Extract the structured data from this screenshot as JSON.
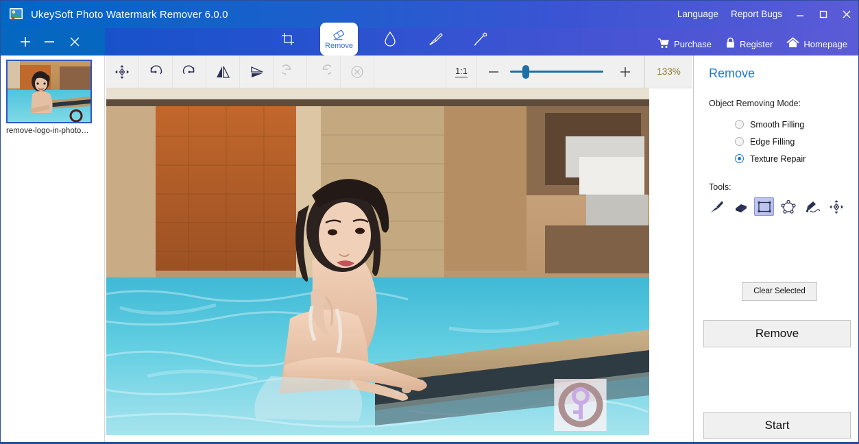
{
  "window": {
    "title": "UkeySoft Photo Watermark Remover 6.0.0",
    "logo_icon": "app-photo-icon",
    "menu": [
      {
        "label": "Language",
        "name": "language-menu"
      },
      {
        "label": "Report Bugs",
        "name": "report-bugs-menu"
      }
    ],
    "controls": [
      {
        "name": "minimize-button",
        "icon": "minimize-icon"
      },
      {
        "name": "maximize-button",
        "icon": "maximize-icon"
      },
      {
        "name": "close-button",
        "icon": "close-icon"
      }
    ]
  },
  "ribbon": {
    "library_actions": [
      {
        "name": "add-image-button",
        "icon": "plus-icon"
      },
      {
        "name": "remove-image-button",
        "icon": "minus-icon"
      },
      {
        "name": "clear-images-button",
        "icon": "close-icon"
      }
    ],
    "tools": [
      {
        "label": "",
        "icon": "crop-icon",
        "name": "tab-crop",
        "active": false
      },
      {
        "label": "Remove",
        "icon": "eraser-icon",
        "name": "tab-remove",
        "active": true
      },
      {
        "label": "",
        "icon": "water-drop-icon",
        "name": "tab-blur",
        "active": false
      },
      {
        "label": "",
        "icon": "brush-icon",
        "name": "tab-brush",
        "active": false
      },
      {
        "label": "",
        "icon": "magic-wand-icon",
        "name": "tab-magic",
        "active": false
      }
    ],
    "links": [
      {
        "label": "Purchase",
        "icon": "cart-icon",
        "name": "purchase-link"
      },
      {
        "label": "Register",
        "icon": "lock-icon",
        "name": "register-link"
      },
      {
        "label": "Homepage",
        "icon": "home-icon",
        "name": "homepage-link"
      }
    ]
  },
  "sidebar": {
    "thumbnail": {
      "filename": "remove-logo-in-photo…",
      "selected": true
    }
  },
  "canvas_toolbar": {
    "buttons": [
      {
        "name": "move-tool-button",
        "icon": "move-icon",
        "disabled": false
      },
      {
        "name": "rotate-left-button",
        "icon": "rotate-left-icon",
        "disabled": false
      },
      {
        "name": "rotate-right-button",
        "icon": "rotate-right-icon",
        "disabled": false
      },
      {
        "name": "flip-horizontal-button",
        "icon": "flip-horizontal-icon",
        "disabled": false
      },
      {
        "name": "flip-vertical-button",
        "icon": "flip-vertical-icon",
        "disabled": false
      },
      {
        "name": "undo-button",
        "icon": "undo-icon",
        "disabled": true
      },
      {
        "name": "redo-button",
        "icon": "redo-icon",
        "disabled": true
      },
      {
        "name": "reset-button",
        "icon": "cancel-circle-icon",
        "disabled": true
      }
    ],
    "fit_ratio_label": "1:1",
    "zoom_out_icon": "minus-icon",
    "zoom_in_icon": "plus-icon",
    "zoom_slider_percent": 14,
    "zoom_value": "133%"
  },
  "panel": {
    "title": "Remove",
    "mode_label": "Object Removing Mode:",
    "modes": [
      {
        "label": "Smooth Filling",
        "selected": false,
        "name": "radio-smooth-filling"
      },
      {
        "label": "Edge Filling",
        "selected": false,
        "name": "radio-edge-filling"
      },
      {
        "label": "Texture Repair",
        "selected": true,
        "name": "radio-texture-repair"
      }
    ],
    "tools_label": "Tools:",
    "tools": [
      {
        "icon": "brush-icon",
        "name": "tool-brush",
        "selected": false
      },
      {
        "icon": "eraser-icon",
        "name": "tool-eraser",
        "selected": false
      },
      {
        "icon": "rectangle-select-icon",
        "name": "tool-rectangle-select",
        "selected": true
      },
      {
        "icon": "polygon-select-icon",
        "name": "tool-polygon-select",
        "selected": false
      },
      {
        "icon": "pen-select-icon",
        "name": "tool-pen-select",
        "selected": false
      },
      {
        "icon": "move-icon",
        "name": "tool-move",
        "selected": false
      }
    ],
    "clear_selected_label": "Clear Selected",
    "remove_label": "Remove",
    "start_label": "Start"
  },
  "colors": {
    "title_blue": "#0067c5",
    "title_purple": "#5b5bd6",
    "accent_blue": "#1878d8",
    "zoom_text": "#8a7a2a",
    "sidebar_blue": "#0567c0"
  }
}
